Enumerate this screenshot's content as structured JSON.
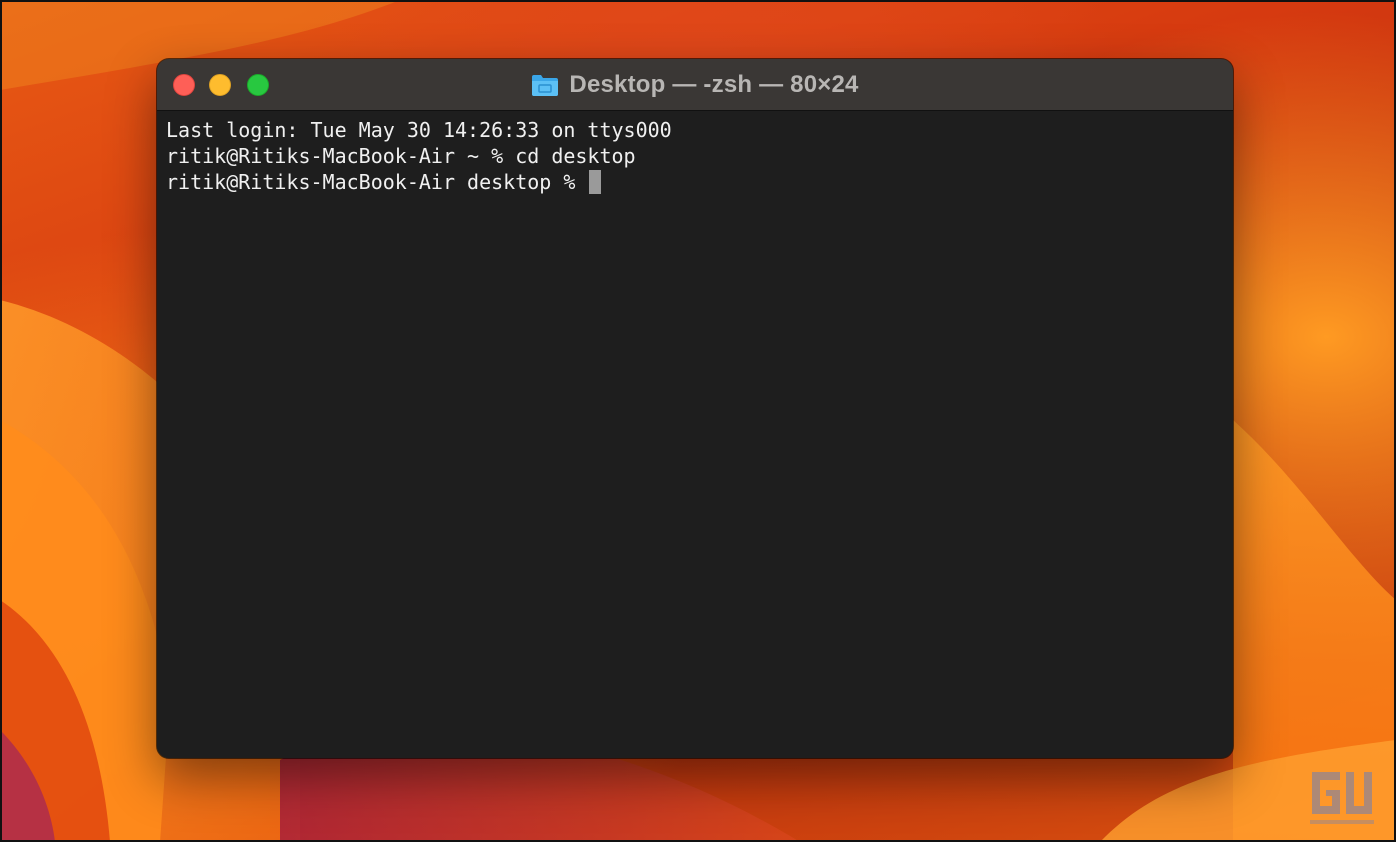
{
  "window": {
    "title": "Desktop — -zsh — 80×24",
    "title_icon": "folder-icon",
    "controls": {
      "close": "close-button",
      "minimize": "minimize-button",
      "zoom": "zoom-button"
    }
  },
  "terminal": {
    "lines": [
      "Last login: Tue May 30 14:26:33 on ttys000",
      "ritik@Ritiks-MacBook-Air ~ % cd desktop",
      "ritik@Ritiks-MacBook-Air desktop % "
    ]
  },
  "colors": {
    "close": "#fe5f57",
    "minimize": "#febc2e",
    "zoom": "#28c840",
    "terminal_bg": "#1e1e1e",
    "titlebar_bg": "#3a3735",
    "text": "#f0f0f0"
  },
  "watermark": {
    "icon": "gadgets-to-use-logo"
  }
}
